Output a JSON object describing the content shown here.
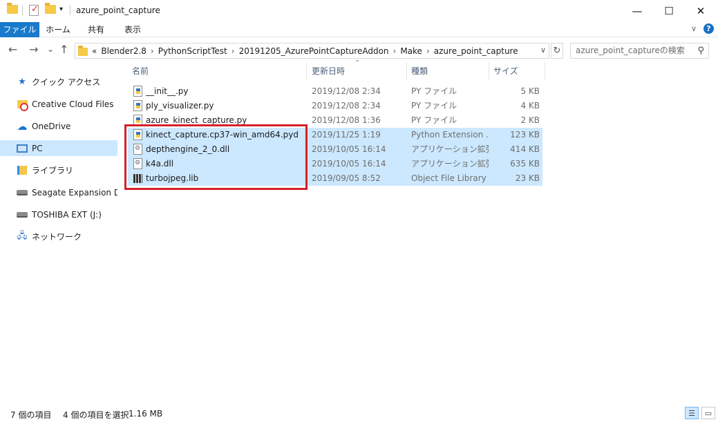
{
  "window": {
    "title": "azure_point_capture",
    "minimize": "—",
    "maximize": "☐",
    "close": "✕"
  },
  "ribbon": {
    "tabs": [
      "ファイル",
      "ホーム",
      "共有",
      "表示"
    ],
    "collapse": "∨",
    "help": "?"
  },
  "nav": {
    "back": "←",
    "forward": "→",
    "recent": "⌄",
    "up": "↑"
  },
  "address": {
    "prefix": "«",
    "crumbs": [
      "Blender2.8",
      "PythonScriptTest",
      "20191205_AzurePointCaptureAddon",
      "Make",
      "azure_point_capture"
    ],
    "separator": "›",
    "dropdown": "∨",
    "refresh": "↻"
  },
  "search": {
    "placeholder": "azure_point_captureの検索",
    "icon": "⚲"
  },
  "sidebar": {
    "items": [
      {
        "label": "クイック アクセス",
        "icon": "star-icon"
      },
      {
        "label": "Creative Cloud Files",
        "icon": "creative-cloud-folder-icon"
      },
      {
        "label": "OneDrive",
        "icon": "cloud-icon"
      },
      {
        "label": "PC",
        "icon": "pc-icon",
        "selected": true
      },
      {
        "label": "ライブラリ",
        "icon": "library-icon"
      },
      {
        "label": "Seagate Expansion Drive",
        "icon": "drive-icon"
      },
      {
        "label": "TOSHIBA EXT (J:)",
        "icon": "drive-icon"
      },
      {
        "label": "ネットワーク",
        "icon": "network-icon"
      }
    ]
  },
  "columns": {
    "name": "名前",
    "date": "更新日時",
    "type": "種類",
    "size": "サイズ",
    "sort_indicator": "⌃"
  },
  "files": [
    {
      "name": "__init__.py",
      "date": "2019/12/08 2:34",
      "type": "PY ファイル",
      "size": "5 KB",
      "icon": "python-file-icon",
      "selected": false
    },
    {
      "name": "ply_visualizer.py",
      "date": "2019/12/08 2:34",
      "type": "PY ファイル",
      "size": "4 KB",
      "icon": "python-file-icon",
      "selected": false
    },
    {
      "name": "azure_kinect_capture.py",
      "date": "2019/12/08 1:36",
      "type": "PY ファイル",
      "size": "2 KB",
      "icon": "python-file-icon",
      "selected": false
    },
    {
      "name": "kinect_capture.cp37-win_amd64.pyd",
      "date": "2019/11/25 1:19",
      "type": "Python Extension ...",
      "size": "123 KB",
      "icon": "python-extension-icon",
      "selected": true
    },
    {
      "name": "depthengine_2_0.dll",
      "date": "2019/10/05 16:14",
      "type": "アプリケーション拡張",
      "size": "414 KB",
      "icon": "dll-file-icon",
      "selected": true
    },
    {
      "name": "k4a.dll",
      "date": "2019/10/05 16:14",
      "type": "アプリケーション拡張",
      "size": "635 KB",
      "icon": "dll-file-icon",
      "selected": true
    },
    {
      "name": "turbojpeg.lib",
      "date": "2019/09/05 8:52",
      "type": "Object File Library",
      "size": "23 KB",
      "icon": "lib-file-icon",
      "selected": true
    }
  ],
  "status": {
    "item_count": "7 個の項目",
    "selection": "4 個の項目を選択",
    "selection_size": "1.16 MB"
  },
  "colors": {
    "accent": "#1979ca",
    "selection": "#cce8ff",
    "highlight_border": "#d4202a"
  }
}
